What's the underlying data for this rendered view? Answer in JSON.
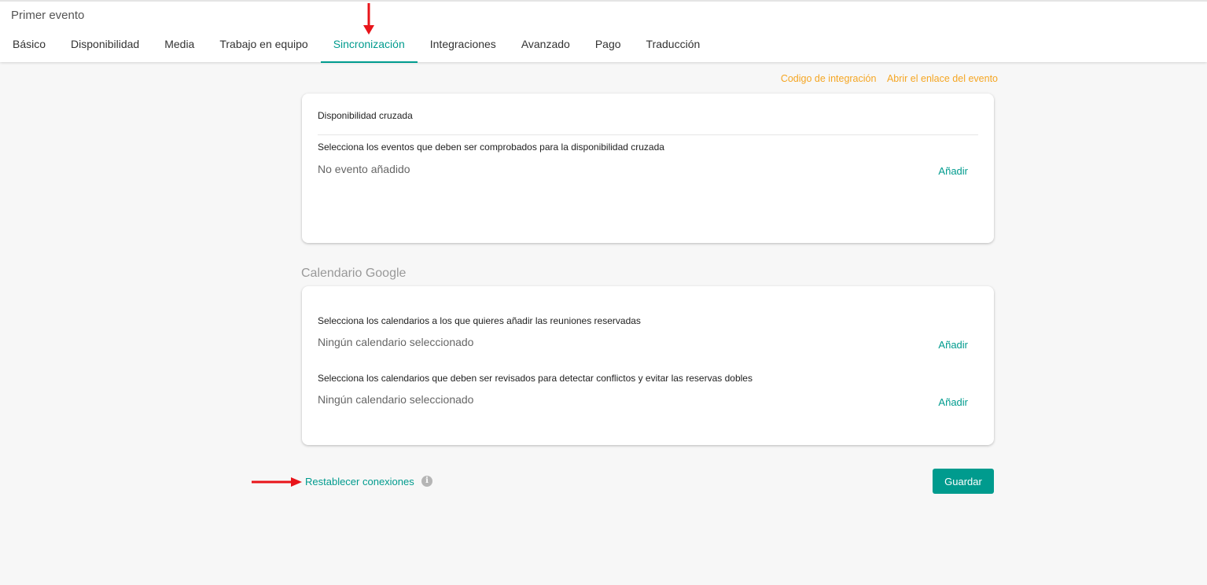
{
  "header": {
    "title": "Primer evento",
    "tabs": [
      {
        "label": "Básico"
      },
      {
        "label": "Disponibilidad"
      },
      {
        "label": "Media"
      },
      {
        "label": "Trabajo en equipo"
      },
      {
        "label": "Sincronización"
      },
      {
        "label": "Integraciones"
      },
      {
        "label": "Avanzado"
      },
      {
        "label": "Pago"
      },
      {
        "label": "Traducción"
      }
    ],
    "active_tab": "Sincronización"
  },
  "links": {
    "integration_code": "Codigo de integración",
    "open_event_link": "Abrir el enlace del evento"
  },
  "cross_availability": {
    "title": "Disponibilidad cruzada",
    "instruction": "Selecciona los eventos que deben ser comprobados para la disponibilidad cruzada",
    "empty": "No evento añadido",
    "add_label": "Añadir"
  },
  "google_calendar": {
    "title": "Calendario Google",
    "add_calendars": {
      "instruction": "Selecciona los calendarios a los que quieres añadir las reuniones reservadas",
      "empty": "Ningún calendario seleccionado",
      "add_label": "Añadir"
    },
    "conflict_calendars": {
      "instruction": "Selecciona los calendarios que deben ser revisados para detectar conflictos y evitar las reservas dobles",
      "empty": "Ningún calendario seleccionado",
      "add_label": "Añadir"
    }
  },
  "footer": {
    "reset_label": "Restablecer conexiones",
    "info_glyph": "i",
    "save_label": "Guardar"
  },
  "colors": {
    "accent": "#009b8e",
    "link_orange": "#f5a623",
    "annotation_red": "#e8141a"
  }
}
